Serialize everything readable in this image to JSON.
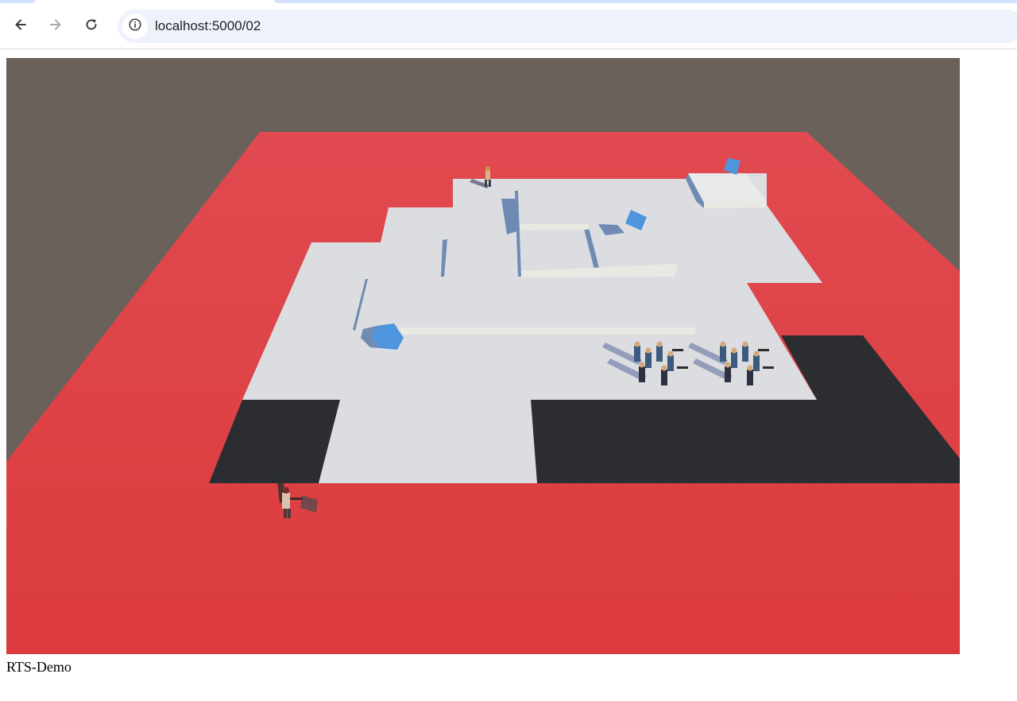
{
  "browser": {
    "url": "localhost:5000/02",
    "back_icon": "back-arrow-icon",
    "forward_icon": "forward-arrow-icon",
    "reload_icon": "reload-icon",
    "site_info_icon": "info-icon"
  },
  "game": {
    "caption": "RTS-Demo",
    "colors": {
      "sky": "#6a615b",
      "ground": "#de3b3e",
      "floor": "#dcdde0",
      "pit": "#2b2d31",
      "crystal": "#4f95dd",
      "wall": "#6f8bb3"
    }
  }
}
